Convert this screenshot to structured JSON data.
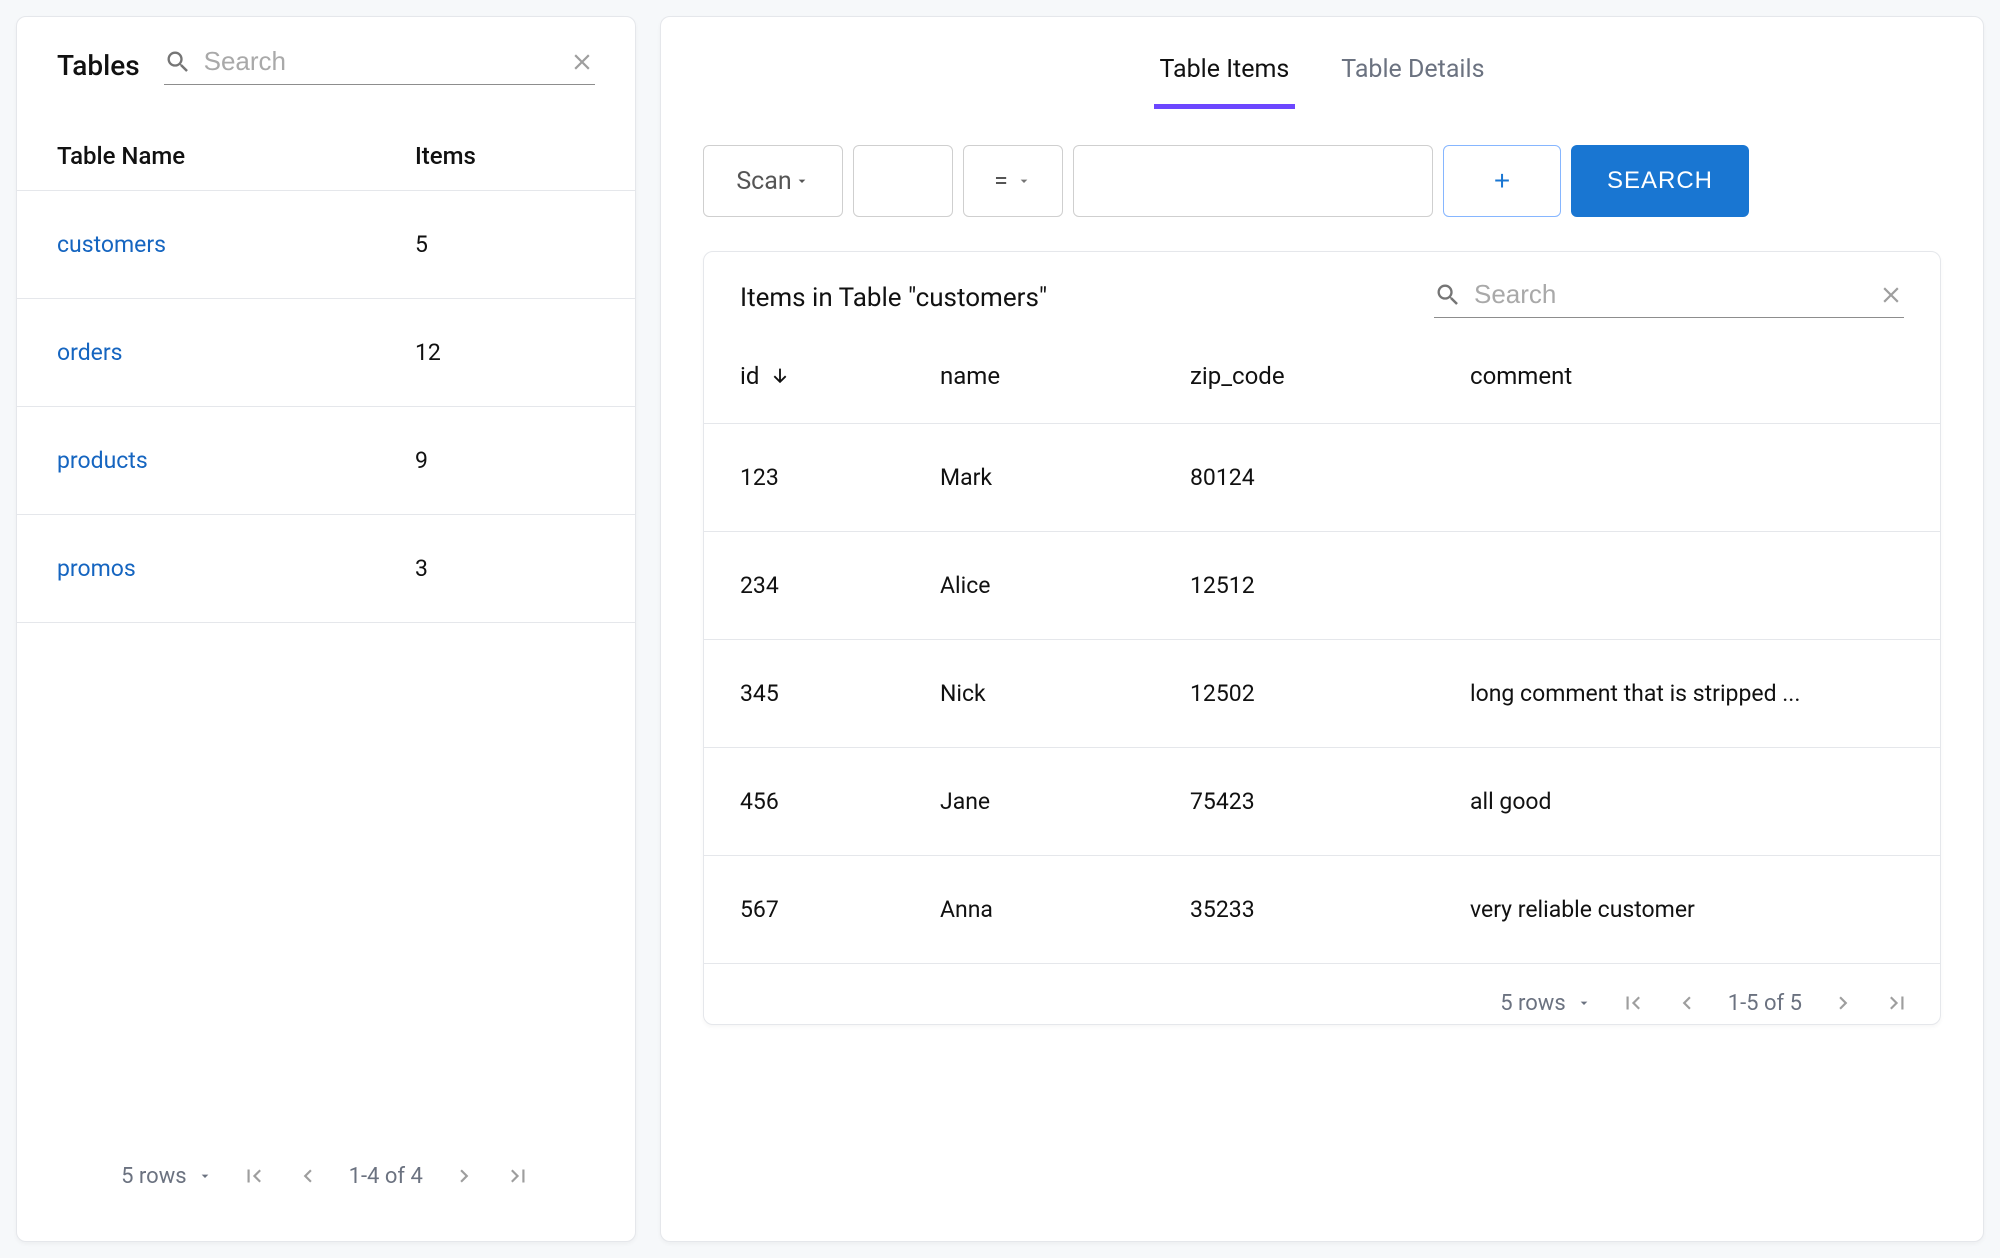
{
  "sidebar": {
    "title": "Tables",
    "search_placeholder": "Search",
    "columns": {
      "name": "Table Name",
      "items": "Items"
    },
    "rows": [
      {
        "name": "customers",
        "items": "5"
      },
      {
        "name": "orders",
        "items": "12"
      },
      {
        "name": "products",
        "items": "9"
      },
      {
        "name": "promos",
        "items": "3"
      }
    ],
    "paginator": {
      "rows_label": "5 rows",
      "range": "1-4 of 4"
    }
  },
  "tabs": {
    "items_label": "Table Items",
    "details_label": "Table Details",
    "active": "items"
  },
  "query": {
    "mode": "Scan",
    "attribute": "",
    "operator": "=",
    "value": "",
    "add_label": "+",
    "search_label": "SEARCH"
  },
  "items": {
    "title": "Items in Table \"customers\"",
    "search_placeholder": "Search",
    "columns": [
      "id",
      "name",
      "zip_code",
      "comment"
    ],
    "sort_column": "id",
    "sort_dir": "desc",
    "rows": [
      {
        "id": "123",
        "name": "Mark",
        "zip_code": "80124",
        "comment": ""
      },
      {
        "id": "234",
        "name": "Alice",
        "zip_code": "12512",
        "comment": ""
      },
      {
        "id": "345",
        "name": "Nick",
        "zip_code": "12502",
        "comment": "long comment that is stripped ..."
      },
      {
        "id": "456",
        "name": "Jane",
        "zip_code": "75423",
        "comment": "all good"
      },
      {
        "id": "567",
        "name": "Anna",
        "zip_code": "35233",
        "comment": "very reliable customer"
      }
    ],
    "paginator": {
      "rows_label": "5 rows",
      "range": "1-5 of 5"
    }
  },
  "colors": {
    "accent": "#6c47ff",
    "primary": "#1976d2",
    "link": "#1565c0"
  }
}
